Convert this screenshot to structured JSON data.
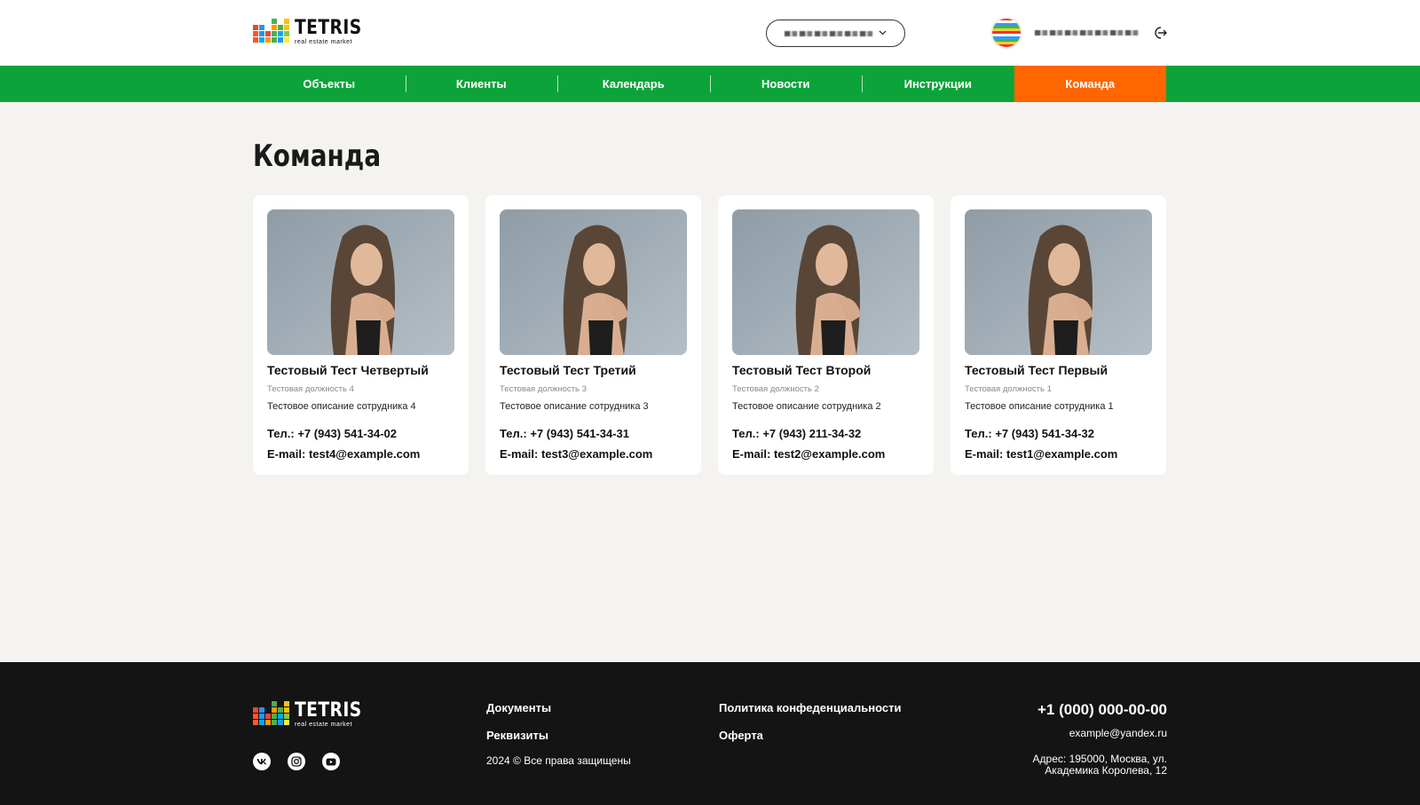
{
  "header": {
    "logo": {
      "word": "TETRIS",
      "sub": "real estate market"
    },
    "city_select": {
      "chevron_icon": "chevron-down-icon"
    },
    "logout_icon": "logout-icon"
  },
  "nav": {
    "items": [
      {
        "label": "Объекты"
      },
      {
        "label": "Клиенты"
      },
      {
        "label": "Календарь"
      },
      {
        "label": "Новости"
      },
      {
        "label": "Инструкции"
      },
      {
        "label": "Команда",
        "active": true
      }
    ],
    "colors": {
      "background": "#0ca43a",
      "active": "#ff6600"
    }
  },
  "main": {
    "title": "Команда",
    "cards": [
      {
        "name": "Тестовый Тест Четвертый",
        "position": "Тестовая должность 4",
        "description": "Тестовое описание сотрудника 4",
        "phone": "Тел.: +7 (943) 541-34-02",
        "email": "E-mail: test4@example.com"
      },
      {
        "name": "Тестовый Тест Третий",
        "position": "Тестовая должность 3",
        "description": "Тестовое описание сотрудника 3",
        "phone": "Тел.: +7 (943) 541-34-31",
        "email": "E-mail: test3@example.com"
      },
      {
        "name": "Тестовый Тест Второй",
        "position": "Тестовая должность 2",
        "description": "Тестовое описание сотрудника 2",
        "phone": "Тел.: +7 (943) 211-34-32",
        "email": "E-mail: test2@example.com"
      },
      {
        "name": "Тестовый Тест Первый",
        "position": "Тестовая должность 1",
        "description": "Тестовое описание сотрудника 1",
        "phone": "Тел.: +7 (943) 541-34-32",
        "email": "E-mail: test1@example.com"
      }
    ]
  },
  "footer": {
    "logo": {
      "word": "TETRIS",
      "sub": "real estate market"
    },
    "links": {
      "documents": "Документы",
      "requisites": "Реквизиты",
      "privacy": "Политика конфеденциальности",
      "offer": "Оферта"
    },
    "copyright": "2024 © Все права защищены",
    "phone": "+1 (000) 000-00-00",
    "email": "example@yandex.ru",
    "address_line1": "Адрес: 195000, Москва, ул.",
    "address_line2": "Академика Королева, 12",
    "socials": [
      {
        "icon": "vk-icon"
      },
      {
        "icon": "instagram-icon"
      },
      {
        "icon": "youtube-icon"
      }
    ]
  }
}
